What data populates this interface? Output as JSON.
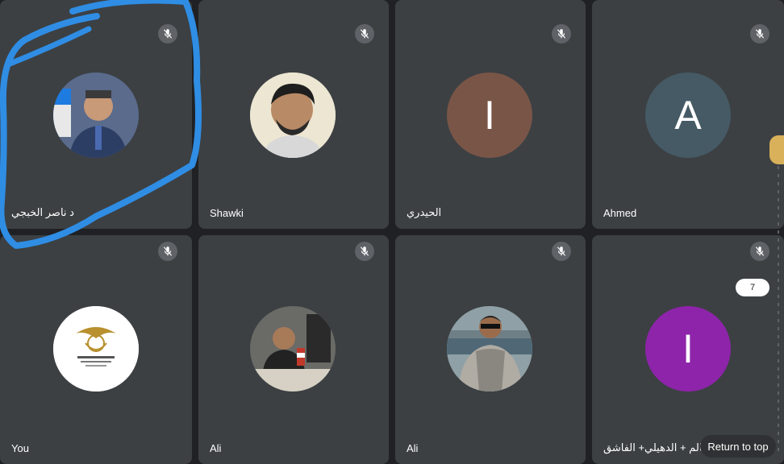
{
  "participants": [
    {
      "name": "د ناصر الخبجي",
      "avatar": "photo",
      "muted": true
    },
    {
      "name": "Shawki",
      "avatar": "photo",
      "muted": true
    },
    {
      "name": "الحيدري",
      "avatar": "letter",
      "letter": "I",
      "color": "#795548",
      "muted": true
    },
    {
      "name": "Ahmed",
      "avatar": "letter",
      "letter": "A",
      "color": "#455a64",
      "muted": true
    },
    {
      "name": "You",
      "avatar": "logo",
      "muted": true
    },
    {
      "name": "Ali",
      "avatar": "photo",
      "muted": true
    },
    {
      "name": "Ali",
      "avatar": "photo",
      "muted": true
    },
    {
      "name": "ظالم + الدهيلي+ الفاشق",
      "avatar": "letter",
      "letter": "I",
      "color": "#8e24aa",
      "muted": true
    }
  ],
  "page_counter": "7",
  "return_to_top_label": "Return to top",
  "colors": {
    "tile": "#3c4043",
    "background": "#202124",
    "annotation": "#2f8de4"
  }
}
